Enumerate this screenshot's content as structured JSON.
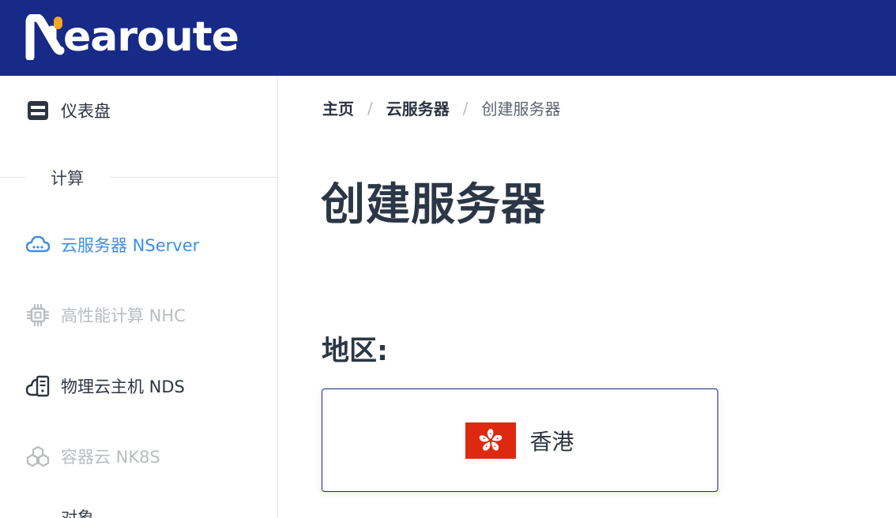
{
  "brand": {
    "name": "earoute"
  },
  "sidebar": {
    "items": [
      {
        "label": "仪表盘",
        "icon": "dashboard-icon",
        "state": "normal"
      },
      {
        "label": "云服务器 NServer",
        "icon": "cloud-server-icon",
        "state": "active"
      },
      {
        "label": "高性能计算 NHC",
        "icon": "chip-icon",
        "state": "disabled"
      },
      {
        "label": "物理云主机 NDS",
        "icon": "cloud-host-icon",
        "state": "normal"
      },
      {
        "label": "容器云 NK8S",
        "icon": "container-icon",
        "state": "disabled"
      }
    ],
    "section_title": "计算",
    "cut_item_label": "对象"
  },
  "breadcrumb": {
    "items": [
      "主页",
      "云服务器",
      "创建服务器"
    ],
    "separator": "/"
  },
  "page": {
    "title": "创建服务器",
    "region_label": "地区:"
  },
  "regions": [
    {
      "name": "香港",
      "flag_icon": "hong-kong-flag-icon",
      "selected": true
    }
  ],
  "colors": {
    "topbar": "#182a87",
    "active": "#3d8fe6",
    "disabled": "#b9bcc2",
    "flag_red": "#de2910"
  }
}
